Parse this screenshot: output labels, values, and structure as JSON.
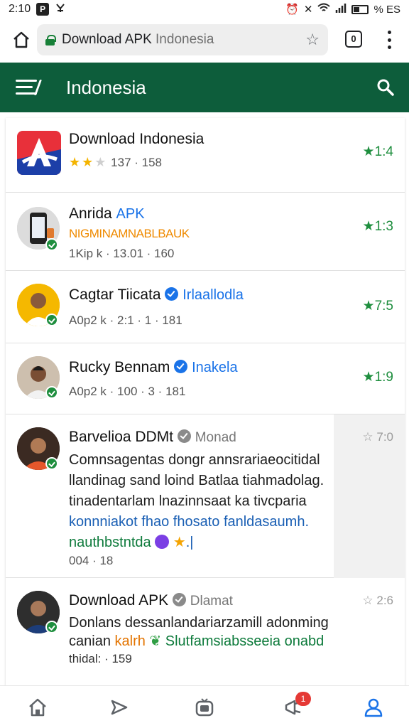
{
  "status_bar": {
    "time": "2:10",
    "app_badge": "P",
    "right_text": "% ES"
  },
  "browser": {
    "url_host": "Download APK",
    "url_rest": "Indonesia",
    "tab_count": "0"
  },
  "app_bar": {
    "title": "Indonesia"
  },
  "items": [
    {
      "name": "Download Indonesia",
      "rating_stars": 2,
      "meta": "137 · 158",
      "score": "1:4"
    },
    {
      "name": "Anrida",
      "handle": "APK",
      "subtitle": "NIGMINAMNABLBAUK",
      "meta": "1Kip k · 13.01 · 160",
      "score": "1:3"
    },
    {
      "name": "Cagtar Tiicata",
      "handle": "Irlaallodla",
      "meta": "A0p2 k · 2:1 · 1 · 181",
      "score": "7:5"
    },
    {
      "name": "Rucky Bennam",
      "handle": "Inakela",
      "meta": "A0p2 k · 100 · 3 · 181",
      "score": "1:9"
    },
    {
      "name": "Barvelioa DDMt",
      "handle": "Monad",
      "body_line1": "Comnsagentas dongr annsrariaeocitidal",
      "body_line2": "llandinag sand loind Batlaa tiahmadolag.",
      "body_line3": "tinadentarlam lnazinnsaat ka tivcparia",
      "body_line4": "konnniakot fhao fhosato fanldasaumh.",
      "body_line5": "nauthbstntda",
      "meta": "004 · 18",
      "score": "7:0"
    },
    {
      "name": "Download APK",
      "handle": "Dlamat",
      "body_line1": "Donlans dessanlandariarzamill adonming",
      "body_line2_a": "canian",
      "body_line2_b": "kalrh",
      "body_line2_c": "Slutfamsiabsseeia onabd",
      "meta": "thidal: · 159",
      "score": "2:6"
    }
  ],
  "bottom_nav": {
    "notification_count": "1"
  },
  "colors": {
    "app_bar": "#0d5d3b",
    "score_green": "#1e8e3e",
    "link_blue": "#1a73e8",
    "accent_orange": "#ef8a00"
  }
}
